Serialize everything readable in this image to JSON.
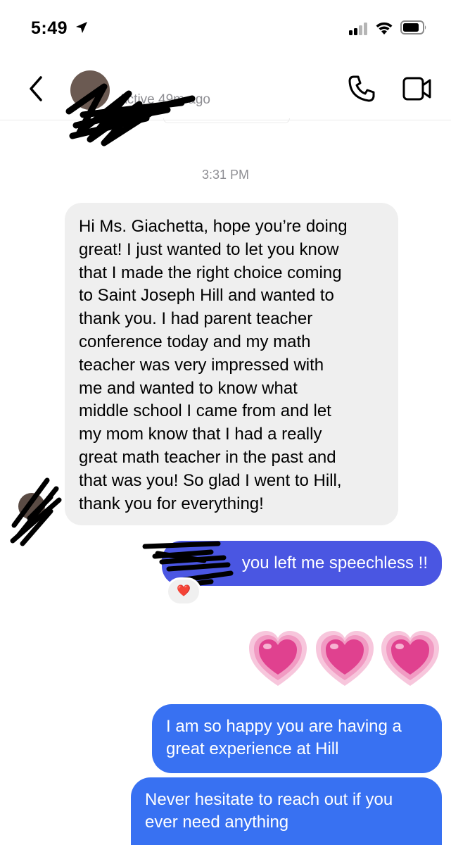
{
  "status_bar": {
    "time": "5:49"
  },
  "header": {
    "contact_name": "",
    "active_status": "Active 49m ago"
  },
  "conversation": {
    "timestamp": "3:31 PM",
    "incoming": {
      "text": "Hi Ms. Giachetta, hope you’re doing\ngreat! I just wanted to let you know\nthat I made the right choice coming\nto Saint Joseph Hill and wanted to\nthank you. I had parent teacher\nconference today and my math\nteacher was very impressed with\nme and wanted to know what\nmiddle school I came from and let\nmy mom know that I had a really\ngreat math teacher in the past and\nthat was you! So glad I went to Hill,\nthank you for everything!"
    },
    "outgoing": [
      {
        "text": "you left me speechless !!",
        "reaction": "❤️"
      },
      {
        "emoji": [
          "growing-heart",
          "growing-heart",
          "growing-heart"
        ]
      },
      {
        "text": "I am so happy you are having a\ngreat experience at Hill"
      },
      {
        "text": "Never hesitate to reach out if you\never need anything"
      }
    ]
  },
  "colors": {
    "incoming_bubble": "#efefef",
    "outgoing_bubble_gradient_top": "#4a56e2",
    "outgoing_bubble": "#3871f2",
    "heart_pink": "#e0418f",
    "reaction_heart": "#e0245e"
  }
}
